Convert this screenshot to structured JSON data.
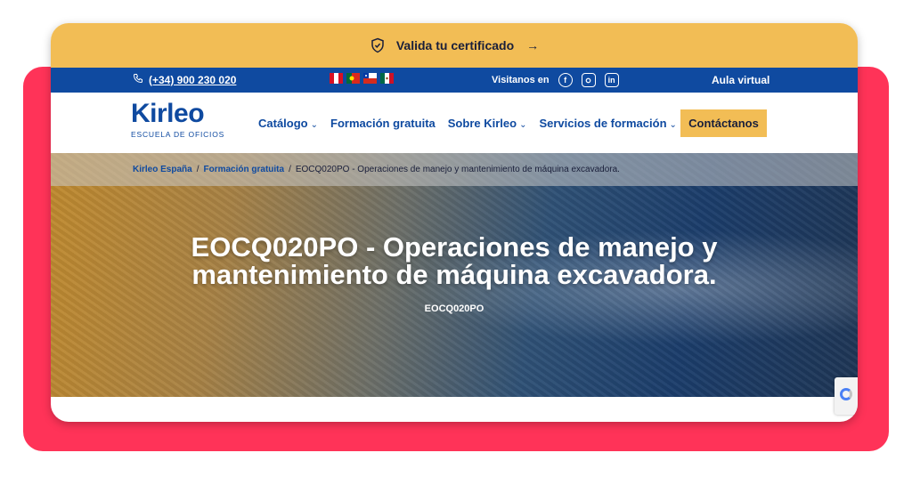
{
  "cert_bar": {
    "label": "Valida tu certificado",
    "arrow": "→"
  },
  "topbar": {
    "phone": "(+34) 900 230 020",
    "visit_label": "Visitanos en",
    "social": [
      "facebook",
      "instagram",
      "linkedin"
    ],
    "aula": "Aula virtual",
    "flags": [
      "peru",
      "portugal",
      "chile",
      "mexico"
    ]
  },
  "nav": {
    "logo_word": "Kirleo",
    "logo_sub": "ESCUELA DE OFICIOS",
    "items": [
      {
        "label": "Catálogo",
        "dropdown": true
      },
      {
        "label": "Formación gratuita",
        "dropdown": false
      },
      {
        "label": "Sobre Kirleo",
        "dropdown": true
      },
      {
        "label": "Servicios de formación",
        "dropdown": true
      }
    ],
    "cta": "Contáctanos"
  },
  "breadcrumb": {
    "items": [
      "Kirleo España",
      "Formación gratuita"
    ],
    "current": "EOCQ020PO - Operaciones de manejo y mantenimiento de máquina excavadora.",
    "separator": "/"
  },
  "hero": {
    "title_line1": "EOCQ020PO - Operaciones de manejo y",
    "title_line2": "mantenimiento de máquina excavadora.",
    "code": "EOCQ020PO"
  },
  "colors": {
    "accent_yellow": "#f2bd55",
    "brand_blue": "#0f4aa0",
    "frame_pink": "#ff3358"
  }
}
